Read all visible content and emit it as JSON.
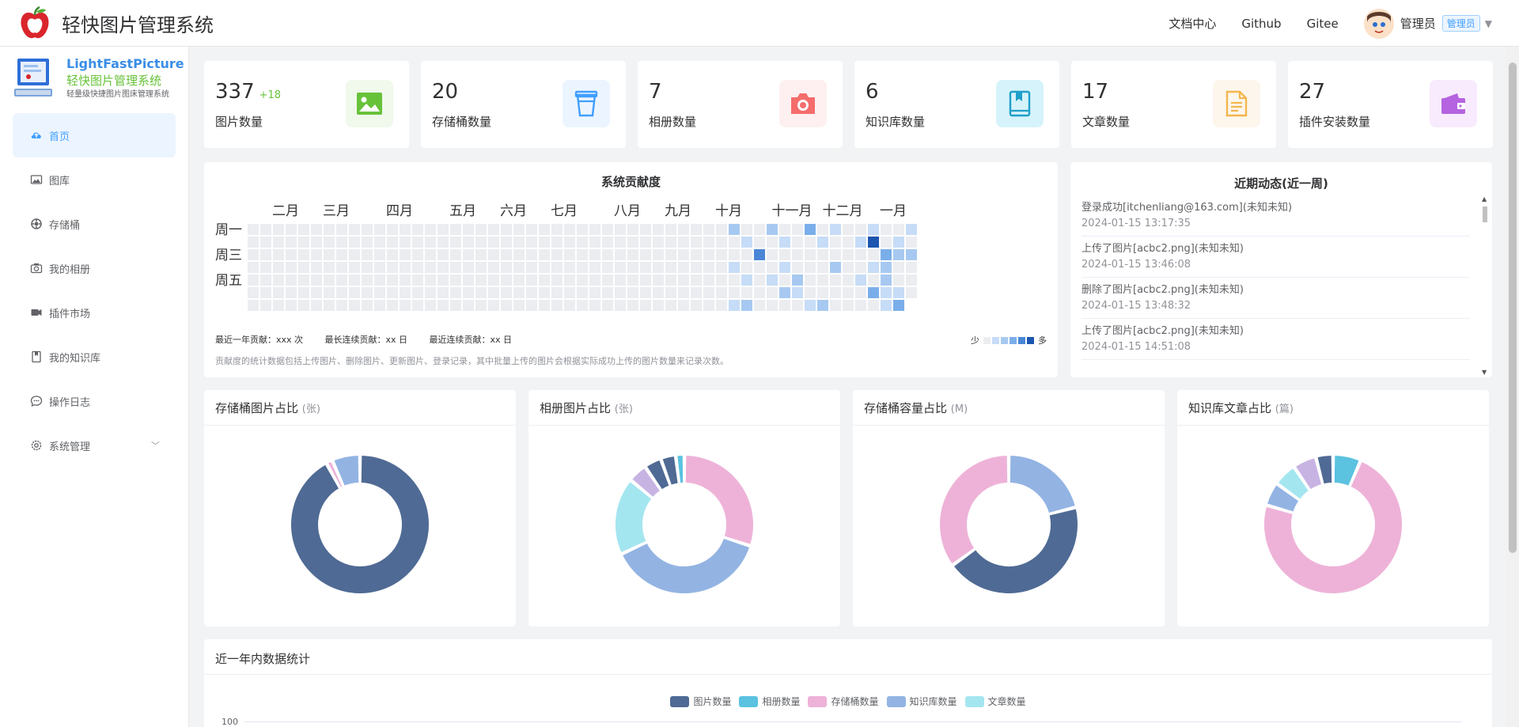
{
  "header": {
    "title": "轻快图片管理系统",
    "nav": [
      "文档中心",
      "Github",
      "Gitee"
    ],
    "user_name": "管理员",
    "role": "管理员"
  },
  "sidebar": {
    "brand_en": "LightFastPicture",
    "brand_cn": "轻快图片管理系统",
    "brand_sub": "轻量级快捷图片图床管理系统",
    "items": [
      {
        "label": "首页",
        "icon": "cloud-upload-icon",
        "active": true
      },
      {
        "label": "图库",
        "icon": "picture-icon"
      },
      {
        "label": "存储桶",
        "icon": "bucket-icon"
      },
      {
        "label": "我的相册",
        "icon": "camera-icon"
      },
      {
        "label": "插件市场",
        "icon": "plugin-icon"
      },
      {
        "label": "我的知识库",
        "icon": "book-icon"
      },
      {
        "label": "操作日志",
        "icon": "chat-icon"
      },
      {
        "label": "系统管理",
        "icon": "gear-icon"
      }
    ]
  },
  "stats": [
    {
      "value": "337",
      "delta": "+18",
      "label": "图片数量",
      "icon": "image-icon",
      "color": "#67c23a",
      "bg": "#f0f9eb"
    },
    {
      "value": "20",
      "delta": "",
      "label": "存储桶数量",
      "icon": "bucket-icon",
      "color": "#409eff",
      "bg": "#ecf5ff"
    },
    {
      "value": "7",
      "delta": "",
      "label": "相册数量",
      "icon": "camera-icon",
      "color": "#f56c6c",
      "bg": "#fef0f0"
    },
    {
      "value": "6",
      "delta": "",
      "label": "知识库数量",
      "icon": "book-icon",
      "color": "#1f9fc9",
      "bg": "#d6f3fb"
    },
    {
      "value": "17",
      "delta": "",
      "label": "文章数量",
      "icon": "document-icon",
      "color": "#f3b64e",
      "bg": "#fdf6ec"
    },
    {
      "value": "27",
      "delta": "",
      "label": "插件安装数量",
      "icon": "wallet-icon",
      "color": "#b563e0",
      "bg": "#f7ebfd"
    }
  ],
  "heatmap": {
    "title": "系统贡献度",
    "months": [
      "二月",
      "三月",
      "四月",
      "五月",
      "六月",
      "七月",
      "八月",
      "九月",
      "十月",
      "十一月",
      "十二月",
      "一月"
    ],
    "weekdays": [
      "周一",
      "周三",
      "周五"
    ],
    "summary": [
      "最近一年贡献：xxx 次",
      "最长连续贡献：xx 日",
      "最近连续贡献：xx 日"
    ],
    "legend_less": "少",
    "legend_more": "多",
    "note": "贡献度的统计数据包括上传图片、删除图片、更新图片、登录记录，其中批量上传的图片会根据实际成功上传的图片数量来记录次数。",
    "levels": [
      "#ebedf0",
      "#c6dcf7",
      "#a7c9f1",
      "#7aaeea",
      "#4a86d6",
      "#1c56b0"
    ]
  },
  "activity": {
    "title": "近期动态(近一周)",
    "items": [
      {
        "text": "登录成功[itchenliang@163.com](未知未知)",
        "time": "2024-01-15 13:17:35"
      },
      {
        "text": "上传了图片[acbc2.png](未知未知)",
        "time": "2024-01-15 13:46:08"
      },
      {
        "text": "删除了图片[acbc2.png](未知未知)",
        "time": "2024-01-15 13:48:32"
      },
      {
        "text": "上传了图片[acbc2.png](未知未知)",
        "time": "2024-01-15 14:51:08"
      }
    ]
  },
  "pies": [
    {
      "title": "存储桶图片占比",
      "unit": "(张)"
    },
    {
      "title": "相册图片占比",
      "unit": "(张)"
    },
    {
      "title": "存储桶容量占比",
      "unit": "(M)"
    },
    {
      "title": "知识库文章占比",
      "unit": "(篇)"
    }
  ],
  "bottom": {
    "title": "近一年内数据统计",
    "legend": [
      {
        "label": "图片数量",
        "color": "#4f6a94"
      },
      {
        "label": "相册数量",
        "color": "#5bc2e0"
      },
      {
        "label": "存储桶数量",
        "color": "#eeb2d8"
      },
      {
        "label": "知识库数量",
        "color": "#93b4e3"
      },
      {
        "label": "文章数量",
        "color": "#a4e6f0"
      }
    ],
    "y_top": "100"
  },
  "chart_data": [
    {
      "type": "pie",
      "title": "存储桶图片占比",
      "values": [
        92,
        1.5,
        6.5
      ],
      "colors": [
        "#4f6a94",
        "#eeb2d8",
        "#93b4e3"
      ]
    },
    {
      "type": "pie",
      "title": "相册图片占比",
      "values": [
        30,
        38,
        18,
        4.5,
        4,
        3.5,
        2
      ],
      "colors": [
        "#eeb2d8",
        "#93b4e3",
        "#a4e6f0",
        "#c8b4e3",
        "#4f6a94",
        "#4f6a94",
        "#5bc2e0"
      ]
    },
    {
      "type": "pie",
      "title": "存储桶容量占比",
      "values": [
        21,
        44,
        35
      ],
      "colors": [
        "#93b4e3",
        "#4f6a94",
        "#eeb2d8"
      ]
    },
    {
      "type": "pie",
      "title": "知识库文章占比",
      "values": [
        6.5,
        73,
        5.5,
        5.5,
        5.5,
        4
      ],
      "colors": [
        "#5bc2e0",
        "#eeb2d8",
        "#93b4e3",
        "#a4e6f0",
        "#c8b4e3",
        "#4f6a94"
      ]
    }
  ]
}
